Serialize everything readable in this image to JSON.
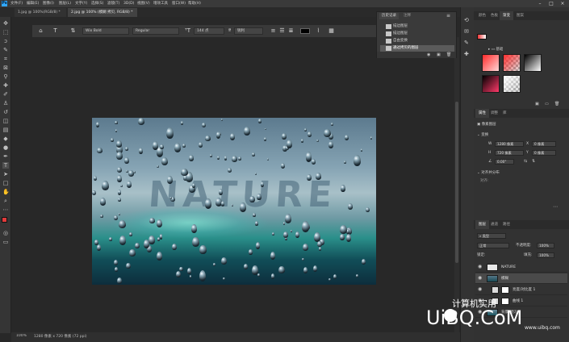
{
  "app": {
    "logo": "Ps"
  },
  "menu": [
    "文件(F)",
    "编辑(E)",
    "图像(I)",
    "图层(L)",
    "文字(Y)",
    "选择(S)",
    "滤镜(T)",
    "3D(D)",
    "视图(V)",
    "增效工具",
    "窗口(W)",
    "帮助(H)"
  ],
  "window_controls": [
    "–",
    "□",
    "×"
  ],
  "doc_tabs": [
    {
      "label": "1.jpg @ 100%(RGB/8) *",
      "active": false
    },
    {
      "label": "2.jpg @ 100% (模糊 拷贝, RGB/8) *",
      "active": true
    }
  ],
  "options": {
    "font_family": "Wix Bold",
    "font_style": "Regular",
    "font_size": "144 点",
    "aa": "锐利",
    "text_color": "#000000"
  },
  "history": {
    "tabs": [
      "历史记录",
      "注释"
    ],
    "items": [
      {
        "label": "描边图层",
        "selected": false
      },
      {
        "label": "描边图层",
        "selected": false
      },
      {
        "label": "自由变换",
        "selected": false
      },
      {
        "label": "通过拷贝的图层",
        "selected": true
      }
    ]
  },
  "canvas": {
    "text": "NATURE",
    "bg_color": "#282828"
  },
  "status": {
    "zoom": "100%",
    "info": "1280 像素 x 720 像素 (72 ppi)"
  },
  "panels": {
    "swatches_tabs": [
      "颜色",
      "色板",
      "渐变",
      "图案"
    ],
    "swatches_active": "渐变",
    "gradient_group": "基础",
    "properties_tabs": [
      "属性",
      "调整",
      "库"
    ],
    "properties_title": "像素图层",
    "transform_title": "变换",
    "transform": {
      "w_label": "W",
      "w_value": "1280 像素",
      "h_label": "H",
      "h_value": "720 像素",
      "x_label": "X",
      "x_value": "0 像素",
      "y_label": "Y",
      "y_value": "0 像素",
      "angle": "0.00°"
    },
    "align_title": "对齐并分布",
    "align_sub": "对齐:",
    "layers_tabs": [
      "图层",
      "通道",
      "路径"
    ],
    "layers_filter": "类型",
    "blend_mode": "正常",
    "opacity_label": "不透明度:",
    "opacity": "100%",
    "lock_label": "锁定:",
    "fill_label": "填充:",
    "fill": "100%",
    "layers": [
      {
        "name": "NATURE",
        "kind": "text"
      },
      {
        "name": "模糊",
        "kind": "pixel"
      },
      {
        "name": "亮度/对比度 1",
        "kind": "adjust"
      },
      {
        "name": "曲线 1",
        "kind": "adjust"
      },
      {
        "name": "背景 拷贝",
        "kind": "pixel"
      }
    ]
  },
  "watermark": {
    "main": "UiBQ.CoM",
    "sub": "计算机实用",
    "url": "www.uibq.com"
  }
}
